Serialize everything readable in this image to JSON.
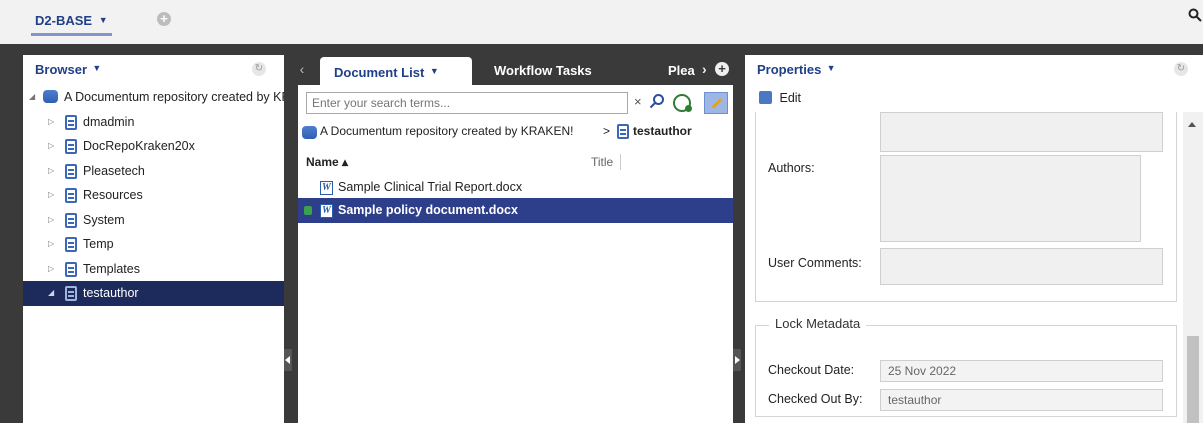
{
  "workspace": {
    "name": "D2-BASE",
    "arrow": "▼",
    "add_icon": "plus-circle-icon",
    "search_icon": "search-icon"
  },
  "browser": {
    "title": "Browser",
    "arrow": "▼",
    "tree": [
      {
        "label": "A Documentum repository created by KRAKEN!",
        "icon": "repository-icon",
        "level": 0,
        "expanded": true
      },
      {
        "label": "dmadmin",
        "icon": "cabinet-icon",
        "level": 1
      },
      {
        "label": "DocRepoKraken20x",
        "icon": "cabinet-icon",
        "level": 1
      },
      {
        "label": "Pleasetech",
        "icon": "cabinet-icon",
        "level": 1
      },
      {
        "label": "Resources",
        "icon": "cabinet-icon",
        "level": 1
      },
      {
        "label": "System",
        "icon": "cabinet-icon",
        "level": 1
      },
      {
        "label": "Temp",
        "icon": "cabinet-icon",
        "level": 1
      },
      {
        "label": "Templates",
        "icon": "cabinet-icon",
        "level": 1
      },
      {
        "label": "testauthor",
        "icon": "cabinet-icon",
        "level": 1,
        "selected": true
      }
    ]
  },
  "tabs": [
    {
      "label": "Document List",
      "arrow": "▼",
      "active": true
    },
    {
      "label": "Workflow Tasks",
      "active": false
    },
    {
      "label": "Plea",
      "active": false
    }
  ],
  "doclist": {
    "search": {
      "placeholder": "Enter your search terms...",
      "value": "",
      "clear": "×"
    },
    "breadcrumb": {
      "root": "A Documentum repository created by KRAKEN!",
      "separator": ">",
      "leaf": "testauthor"
    },
    "columns": {
      "name": "Name",
      "sort_indicator": "▴",
      "title": "Title"
    },
    "rows": [
      {
        "name": "Sample Clinical Trial Report.docx",
        "icon": "word-icon",
        "icon_letter": "W",
        "locked": false,
        "selected": false
      },
      {
        "name": "Sample policy document.docx",
        "icon": "word-icon",
        "icon_letter": "W",
        "locked": true,
        "selected": true
      }
    ]
  },
  "properties": {
    "title": "Properties",
    "arrow": "▼",
    "edit_label": "Edit",
    "authors_label": "Authors:",
    "user_comments_label": "User Comments:",
    "lock_group_title": "Lock Metadata",
    "checkout_date_label": "Checkout Date:",
    "checkout_date_value": "25 Nov 2022",
    "checked_out_by_label": "Checked Out By:",
    "checked_out_by_value": "testauthor"
  },
  "colors": {
    "accent": "#1f3f88",
    "selection": "#1d2a5c",
    "background": "#3a3a3a"
  }
}
